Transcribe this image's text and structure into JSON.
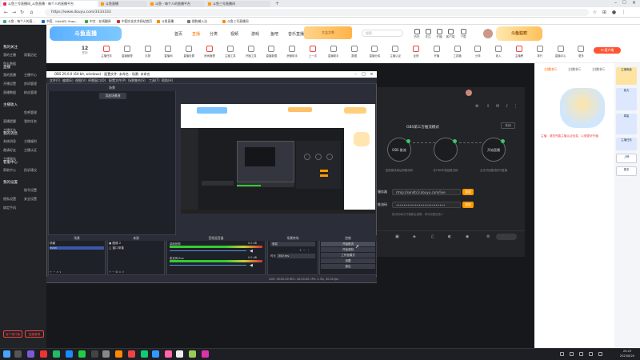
{
  "browser": {
    "tabs": [
      {
        "label": "斗鱼三号直播间_斗鱼直播 - 每个人的直播平台"
      },
      {
        "label": "斗鱼直播"
      },
      {
        "label": "斗鱼 - 每个人的直播平台"
      },
      {
        "label": "斗鱼三号直播间"
      }
    ],
    "url": "https://www.douyu.com/3333333",
    "bookmarks": [
      "斗鱼 - 每个人的直...",
      "书签 - Intel(R) Grap...",
      "中文 - 在线翻译",
      "中国文化艺术网站首页",
      "斗鱼直播",
      "搜狗输入法",
      "斗鱼三号直播间"
    ]
  },
  "site": {
    "logo": "斗鱼直播",
    "nav": [
      "首页",
      "直播",
      "分类",
      "视频",
      "游戏",
      "鱼吧",
      "音乐直播"
    ],
    "active_nav": "直播",
    "promo": "大吉大利",
    "search_placeholder": "搜索",
    "header_icons": [
      "历史",
      "关注",
      "开播",
      "客户端",
      "下载"
    ],
    "badge": "斗鱼狂欢",
    "day": "12",
    "day_sub": "签到",
    "tools": [
      "主播任务",
      "直播管理",
      "礼物",
      "直播间",
      "直播设置",
      "房间管理",
      "主播工具",
      "开播工具",
      "直播数据",
      "房管助手",
      "上一次",
      "直播助手",
      "数据",
      "直播分成",
      "主播认证",
      "反馈",
      "开播",
      "工具箱",
      "分享",
      "收入",
      "主播榜",
      "排行",
      "直播中心",
      "更多"
    ],
    "pc_button": "PC客户端"
  },
  "sidebar": {
    "items": [
      "我的关注",
      "我的主播",
      "观看历史",
      "鱼丸数据",
      "直播",
      "我的直播",
      "主播中心",
      "开播设置",
      "房间管理",
      "直播数据",
      "粉丝管理",
      "主播收入",
      "鱼吧管理",
      "直播提醒",
      "我的任务",
      "主播任务",
      "我的消息",
      "系统消息",
      "主播福利",
      "邀请好友",
      "主播认证",
      "主播服务",
      "客服中心",
      "帮助中心",
      "投诉建议",
      "我的设置",
      "账号设置",
      "隐私设置",
      "安全设置",
      "绑定手机"
    ],
    "bottom_buttons": [
      "客户端开播",
      "直播管理"
    ]
  },
  "stream_panel": {
    "title": "OBS第三方推流模式",
    "close": "关闭",
    "steps": [
      {
        "label": "OBS 推流",
        "caption": "复制推流地址和推流码"
      },
      {
        "label": "",
        "caption": "在OBS中粘贴推流码"
      },
      {
        "label": "开始直播",
        "caption": "点击开始推流即可直播"
      }
    ],
    "server_label": "服务器",
    "server_value": "rtmp://sendtc3.douyu.com/live",
    "key_label": "推流码",
    "key_value": "••••••••••••••••••••••••••",
    "copy": "复制",
    "note": "推流码每次开播都会重置，请勿泄露给他人"
  },
  "right_panel": {
    "tabs": [
      "主播排行",
      "主播排行",
      "主播排行"
    ],
    "message": "主播：请您完善主播认证信息，以便更好开播",
    "far_right": [
      "主播等级",
      "鱼丸",
      "周星",
      "主播任务",
      "上榜",
      "更多"
    ]
  },
  "obs": {
    "title": "OBS 29.0.0 (64-bit, windows) - 配置文件: 未命名 - 场景: 未命名",
    "menu": [
      "文件(F)",
      "编辑(E)",
      "视图(V)",
      "停靠窗口(D)",
      "配置文件(P)",
      "场景集合(S)",
      "工具(T)",
      "帮助(H)"
    ],
    "sources_header": "场景",
    "add_source": "添加场景源",
    "docks": {
      "scenes_title": "场景",
      "scenes": [
        "场景",
        "main"
      ],
      "sources_title": "来源",
      "sources": [
        "图像 2",
        "窗口采集"
      ],
      "mixer_title": "音频混音器",
      "mixer_tracks": [
        {
          "name": "桌面音频",
          "db": "0.0 dB"
        },
        {
          "name": "麦克风/Aux",
          "db": "0.0 dB"
        }
      ],
      "transitions_title": "场景转场",
      "transition_value": "渐变",
      "duration_label": "时长",
      "duration_value": "300 ms",
      "controls_title": "控制",
      "controls": [
        "开始推流",
        "开始录制",
        "工作室模式",
        "设置",
        "退出"
      ]
    },
    "status": "LIVE: 00:00:00    REC: 00:00:00    CPU: 2.3%, 30.00 fps"
  },
  "taskbar": {
    "time": "20:25",
    "date": "2023/8/20"
  }
}
